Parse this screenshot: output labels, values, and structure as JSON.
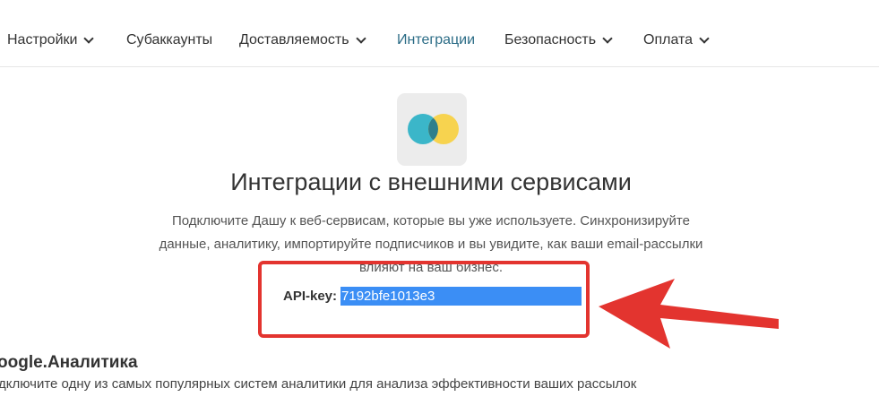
{
  "nav": {
    "items": [
      {
        "label": "Настройки",
        "dropdown": true,
        "active": false
      },
      {
        "label": "Субаккаунты",
        "dropdown": false,
        "active": false
      },
      {
        "label": "Доставляемость",
        "dropdown": true,
        "active": false
      },
      {
        "label": "Интеграции",
        "dropdown": false,
        "active": true
      },
      {
        "label": "Безопасность",
        "dropdown": true,
        "active": false
      },
      {
        "label": "Оплата",
        "dropdown": true,
        "active": false
      }
    ]
  },
  "hero": {
    "logo_icon": "integrations-logo-icon",
    "title": "Интеграции с внешними сервисами",
    "description": "Подключите Дашу к веб-сервисам, которые вы уже используете. Синхронизируйте данные, аналитику, импортируйте подписчиков и вы увидите, как ваши email-рассылки влияют на ваш бизнес."
  },
  "api": {
    "label": "API-key:",
    "value": "7192bfe1013e3"
  },
  "integrations": {
    "google": {
      "title": "oogle.Аналитика",
      "description": "дключите одну из самых популярных систем аналитики для анализа эффективности ваших рассылок"
    }
  },
  "colors": {
    "active_nav": "#2b6c86",
    "highlight": "#3b8ef5",
    "annotation_red": "#e3342f",
    "logo_teal": "#3bb6c9",
    "logo_yellow": "#f7d34f"
  }
}
